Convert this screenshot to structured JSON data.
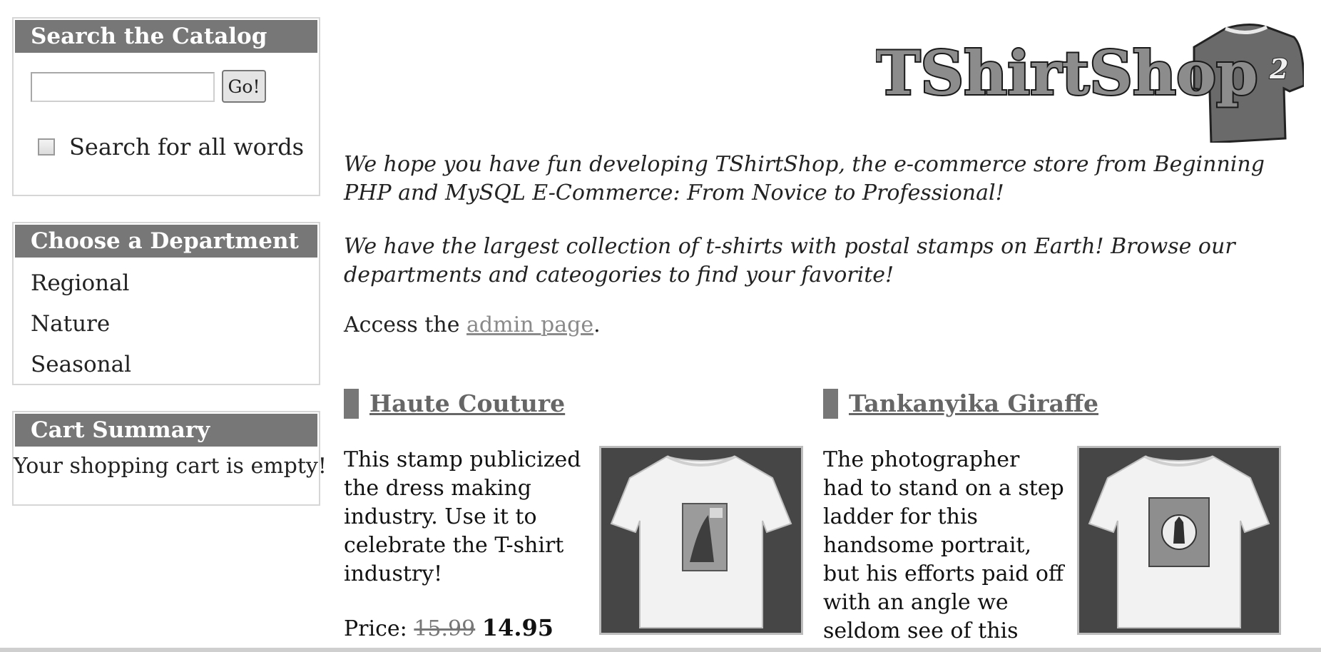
{
  "search": {
    "title": "Search the Catalog",
    "input_value": "",
    "go_label": "Go!",
    "all_words_label": "Search for all words",
    "all_words_checked": false
  },
  "departments": {
    "title": "Choose a Department",
    "items": [
      {
        "label": "Regional"
      },
      {
        "label": "Nature"
      },
      {
        "label": "Seasonal"
      }
    ]
  },
  "cart": {
    "title": "Cart Summary",
    "status": "Your shopping cart is empty!"
  },
  "logo": {
    "text": "TShirtShop",
    "superscript": "2"
  },
  "intro": {
    "paragraph_1": "We hope you have fun developing TShirtShop, the e-commerce store from Beginning PHP and MySQL E-Commerce: From Novice to Professional!",
    "paragraph_2": "We have the largest collection of t-shirts with postal stamps on Earth! Browse our departments and cateogories to find your favorite!",
    "access_prefix": "Access the",
    "admin_link": "admin page",
    "access_suffix": "."
  },
  "products": [
    {
      "name": "Haute Couture",
      "description": "This stamp publicized the dress making industry. Use it to celebrate the T-shirt industry!",
      "price_label": "Price:",
      "old_price": "15.99",
      "new_price": "14.95"
    },
    {
      "name": "Tankanyika Giraffe",
      "description": "The photographer had to stand on a step ladder for this handsome portrait, but his efforts paid off with an angle we seldom see of this"
    }
  ],
  "colors": {
    "panel_header": "#777777",
    "link": "#8a8a8a",
    "image_background": "#464646"
  }
}
